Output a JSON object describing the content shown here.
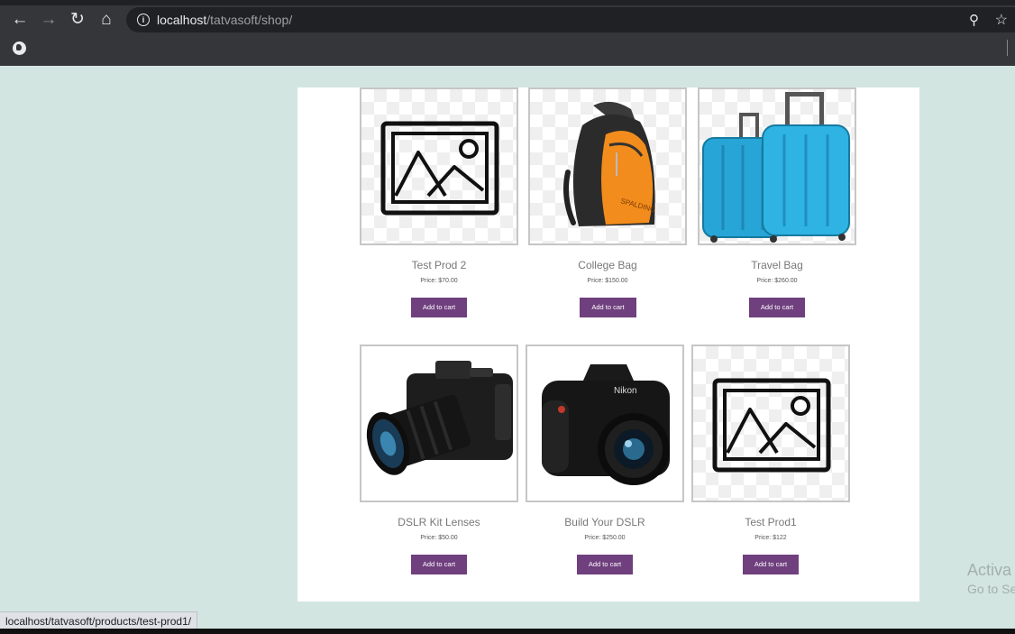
{
  "browser": {
    "url_host": "localhost",
    "url_path": "/tatvasoft/shop/",
    "icons": [
      "back-arrow-icon",
      "forward-arrow-icon",
      "reload-icon",
      "home-icon",
      "info-icon",
      "zoom-icon",
      "star-icon",
      "globe-icon"
    ]
  },
  "products": [
    {
      "name": "Test Prod 2",
      "price": "Price: $70.00",
      "button": "Add to cart",
      "image": "placeholder-image-icon"
    },
    {
      "name": "College Bag",
      "price": "Price: $150.00",
      "button": "Add to cart",
      "image": "backpack"
    },
    {
      "name": "Travel Bag",
      "price": "Price: $260.00",
      "button": "Add to cart",
      "image": "suitcases"
    },
    {
      "name": "DSLR Kit Lenses",
      "price": "Price: $50.00",
      "button": "Add to cart",
      "image": "dslr-camera"
    },
    {
      "name": "Build Your DSLR",
      "price": "Price: $250.00",
      "button": "Add to cart",
      "image": "nikon-camera"
    },
    {
      "name": "Test Prod1",
      "price": "Price: $122",
      "button": "Add to cart",
      "image": "placeholder-image-icon"
    }
  ],
  "watermark": {
    "line1": "Activa",
    "line2": "Go to Se"
  },
  "status_bar": {
    "link": "localhost/tatvasoft/products/test-prod1/"
  },
  "colors": {
    "button": "#6f3f7e",
    "page_background": "#d3e5e0",
    "browser_chrome": "#35363a"
  }
}
